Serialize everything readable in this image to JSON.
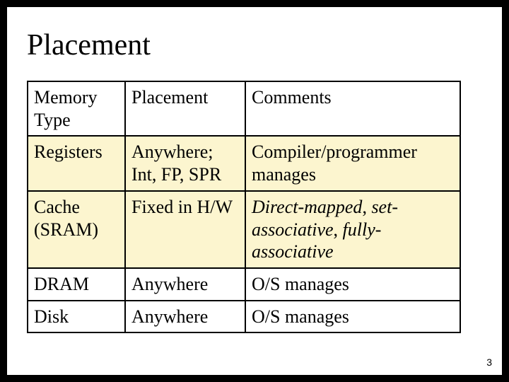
{
  "title": "Placement",
  "page_number": "3",
  "table": {
    "header": {
      "c1": "Memory Type",
      "c2": "Placement",
      "c3": "Comments"
    },
    "rows": [
      {
        "c1": "Registers",
        "c2": "Anywhere; Int, FP, SPR",
        "c3": "Compiler/programmer manages"
      },
      {
        "c1": "Cache (SRAM)",
        "c2": "Fixed in H/W",
        "c3_i1": "Direct-mapped",
        "c3_sep1": ", ",
        "c3_i2": "set-associative",
        "c3_sep2": ", ",
        "c3_i3": "fully-associative"
      },
      {
        "c1": "DRAM",
        "c2": "Anywhere",
        "c3": "O/S manages"
      },
      {
        "c1": "Disk",
        "c2": "Anywhere",
        "c3": "O/S manages"
      }
    ]
  }
}
